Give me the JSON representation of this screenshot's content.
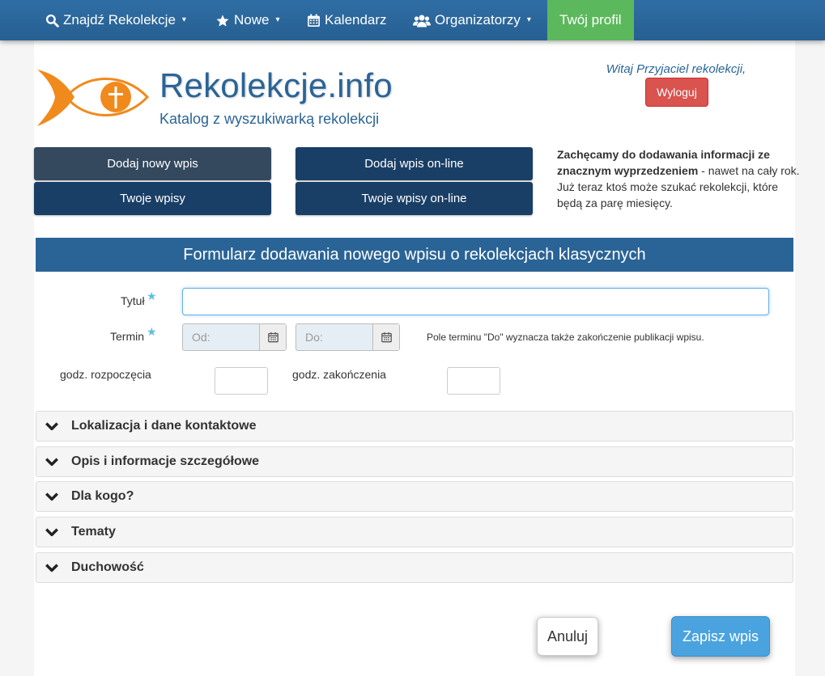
{
  "navbar": {
    "items": [
      {
        "label": "Znajdź Rekolekcje",
        "icon": "search-icon",
        "dropdown": true
      },
      {
        "label": "Nowe",
        "icon": "star-icon",
        "dropdown": true
      },
      {
        "label": "Kalendarz",
        "icon": "calendar-icon",
        "dropdown": false
      },
      {
        "label": "Organizatorzy",
        "icon": "users-icon",
        "dropdown": true
      }
    ],
    "profile_label": "Twój profil",
    "caret": "▾"
  },
  "header": {
    "site_title": "Rekolekcje.info",
    "subtitle": "Katalog z wyszukiwarką rekolekcji",
    "welcome": "Witaj Przyjaciel rekolekcji,",
    "logout_label": "Wyloguj"
  },
  "actions": {
    "add_entry": "Dodaj nowy wpis",
    "add_online": "Dodaj wpis on-line",
    "your_entries": "Twoje wpisy",
    "your_online": "Twoje wpisy on-line"
  },
  "promo": {
    "bold": "Zachęcamy do dodawania informacji ze znacznym wyprzedzeniem",
    "rest": " - nawet na cały rok. Już teraz ktoś może szukać rekolekcji, które będą za parę miesięcy."
  },
  "form": {
    "title": "Formularz dodawania nowego wpisu o rekolekcjach klasycznych",
    "title_label": "Tytuł",
    "title_value": "",
    "term_label": "Termin",
    "from_placeholder": "Od:",
    "to_placeholder": "Do:",
    "term_hint": "Pole terminu \"Do\" wyznacza także zakończenie publikacji wpisu.",
    "start_time_label": "godz. rozpoczęcia",
    "end_time_label": "godz. zakończenia",
    "required_mark": "★"
  },
  "sections": [
    "Lokalizacja i dane kontaktowe",
    "Opis i informacje szczegółowe",
    "Dla kogo?",
    "Tematy",
    "Duchowość"
  ],
  "buttons": {
    "cancel": "Anuluj",
    "save": "Zapisz wpis"
  },
  "colors": {
    "navbar": "#2a6496",
    "profile": "#5cb85c",
    "logout": "#d9534f",
    "save": "#4aa3df"
  }
}
